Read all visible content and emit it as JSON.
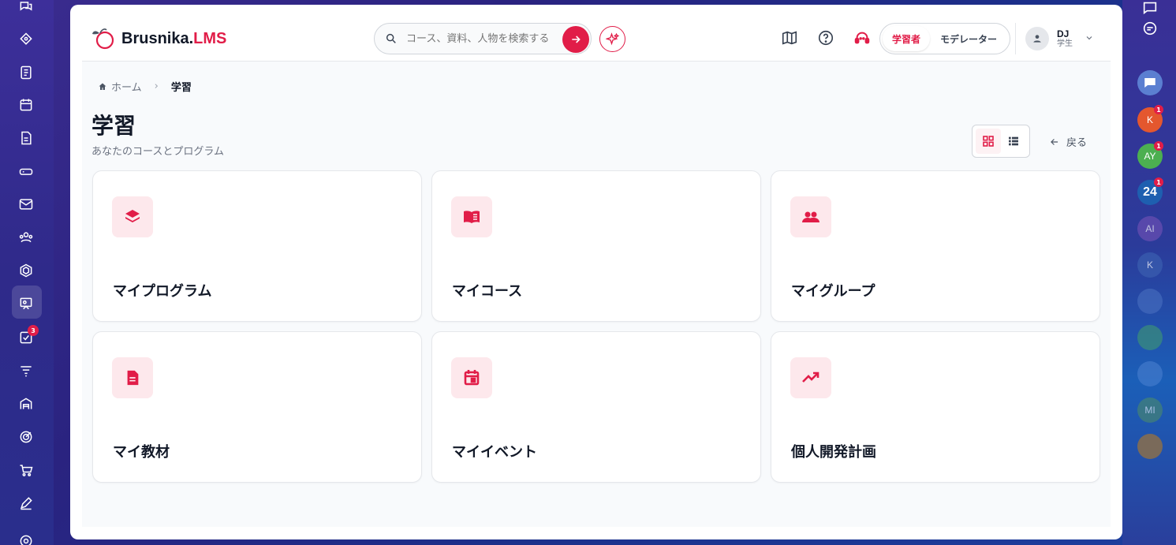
{
  "left_rail": {
    "items": [
      {
        "icon": "chat-bubbles-icon",
        "badge": ""
      },
      {
        "icon": "rocket-icon",
        "badge": ""
      },
      {
        "icon": "notebook-icon",
        "badge": ""
      },
      {
        "icon": "calendar-icon",
        "badge": ""
      },
      {
        "icon": "document-icon",
        "badge": ""
      },
      {
        "icon": "drive-icon",
        "badge": ""
      },
      {
        "icon": "mail-icon",
        "badge": ""
      },
      {
        "icon": "people-icon",
        "badge": ""
      },
      {
        "icon": "hexagon-icon",
        "badge": ""
      },
      {
        "icon": "presentation-icon",
        "badge": ""
      },
      {
        "icon": "checkbox-icon",
        "badge": "3"
      },
      {
        "icon": "funnel-icon",
        "badge": ""
      },
      {
        "icon": "warehouse-icon",
        "badge": ""
      },
      {
        "icon": "target-icon",
        "badge": ""
      },
      {
        "icon": "cart-icon",
        "badge": ""
      },
      {
        "icon": "pen-icon",
        "badge": ""
      },
      {
        "icon": "settings-icon",
        "badge": ""
      }
    ]
  },
  "right_rail": {
    "avatars": [
      {
        "initials": "",
        "icon": "chat-icon",
        "badge": ""
      },
      {
        "initials": "",
        "icon": "support-chat-icon",
        "badge": ""
      },
      {
        "initials": "",
        "icon": "message-icon",
        "badge": ""
      },
      {
        "initials": "K",
        "badge": "1",
        "color": "#e4572e"
      },
      {
        "initials": "AY",
        "badge": "1",
        "color": "#4caf50"
      },
      {
        "initials": "24",
        "badge": "1",
        "color": "#1e5fb0"
      },
      {
        "initials": "AI",
        "badge": "",
        "color": "#6b4fb3"
      },
      {
        "initials": "K",
        "badge": "",
        "color": "#3b5fb0"
      },
      {
        "initials": "",
        "badge": "",
        "color": "#4a6fc0"
      },
      {
        "initials": "",
        "badge": "",
        "color": "#3f9a6f"
      },
      {
        "initials": "",
        "badge": "",
        "color": "#4a7fcf"
      },
      {
        "initials": "MI",
        "badge": "",
        "color": "#4b8a6a"
      },
      {
        "initials": "",
        "badge": "",
        "color": "#7a6a5a"
      }
    ]
  },
  "header": {
    "logo_text": "Brusnika.",
    "logo_accent": "LMS",
    "search_placeholder": "コース、資料、人物を検索する",
    "role_learner": "学習者",
    "role_moderator": "モデレーター",
    "user_name": "DJ",
    "user_role": "学生"
  },
  "breadcrumb": {
    "home": "ホーム",
    "separator": "›",
    "current": "学習"
  },
  "page": {
    "title": "学習",
    "subtitle": "あなたのコースとプログラム",
    "back_label": "戻る"
  },
  "tiles": [
    {
      "label": "マイプログラム",
      "icon": "layers-icon"
    },
    {
      "label": "マイコース",
      "icon": "book-icon"
    },
    {
      "label": "マイグループ",
      "icon": "group-icon"
    },
    {
      "label": "マイ教材",
      "icon": "document-icon"
    },
    {
      "label": "マイイベント",
      "icon": "calendar-event-icon"
    },
    {
      "label": "個人開発計画",
      "icon": "trending-up-icon"
    }
  ],
  "colors": {
    "accent": "#e11d48",
    "accent_bg": "#fde8ec"
  }
}
